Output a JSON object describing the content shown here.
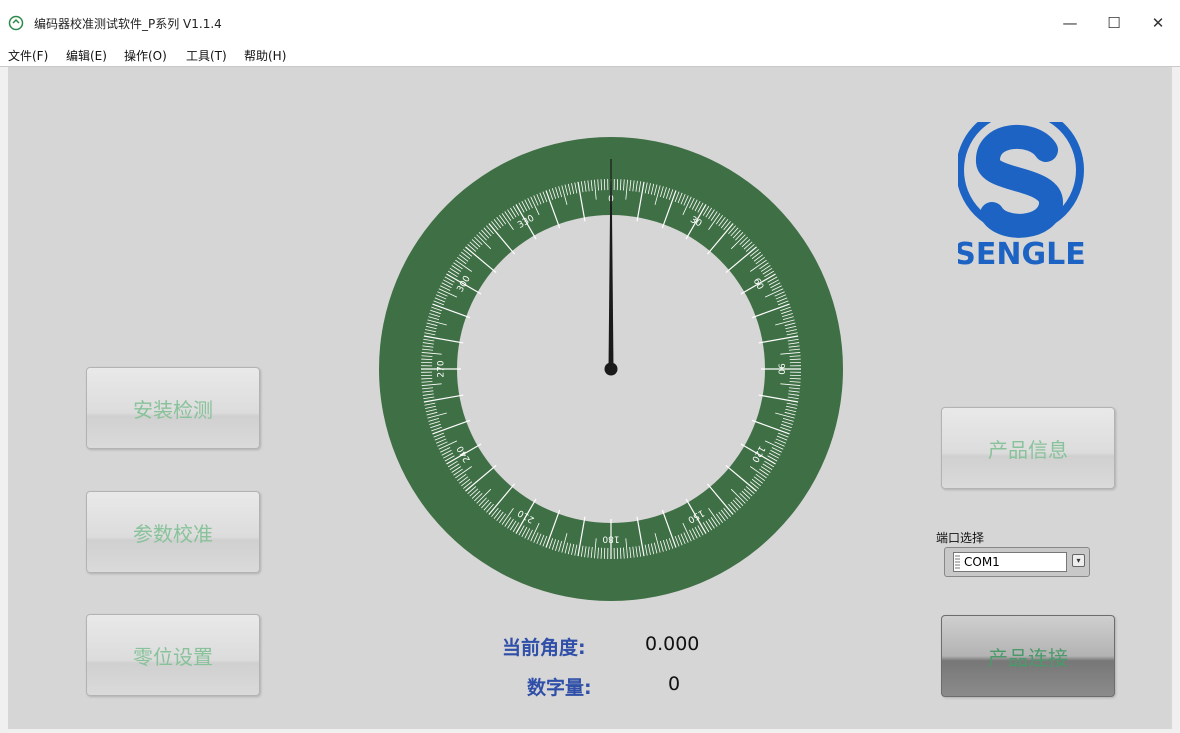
{
  "window": {
    "title": "编码器校准测试软件_P系列 V1.1.4",
    "controls": {
      "minimize": "—",
      "maximize": "☐",
      "close": "✕"
    }
  },
  "menu": [
    {
      "label": "文件(F)"
    },
    {
      "label": "编辑(E)"
    },
    {
      "label": "操作(O)"
    },
    {
      "label": "工具(T)"
    },
    {
      "label": "帮助(H)"
    }
  ],
  "buttons": {
    "install_check": "安装检测",
    "param_calibrate": "参数校准",
    "zero_set": "零位设置",
    "product_info": "产品信息",
    "product_connect": "产品连接"
  },
  "gauge": {
    "angle_deg": 0,
    "scale_min": 0,
    "scale_max": 360,
    "major_labels": [
      "0",
      "30",
      "60",
      "90",
      "120",
      "150",
      "180",
      "210",
      "240",
      "270",
      "300",
      "330"
    ],
    "ring_color": "#3f6f45",
    "tick_color": "#ffffff",
    "needle_color": "#1a1a1a"
  },
  "readout": {
    "angle_label": "当前角度:",
    "angle_value": "0.000",
    "digital_label": "数字量:",
    "digital_value": "0"
  },
  "logo": {
    "text": "SENGLE",
    "color": "#1c63c4"
  },
  "port": {
    "label": "端口选择",
    "value": "COM1",
    "icon": "dropdown-arrow-icon"
  },
  "colors": {
    "button_text": "#88c29a",
    "readout_label": "#2f4fa8",
    "background": "#d6d6d6"
  }
}
